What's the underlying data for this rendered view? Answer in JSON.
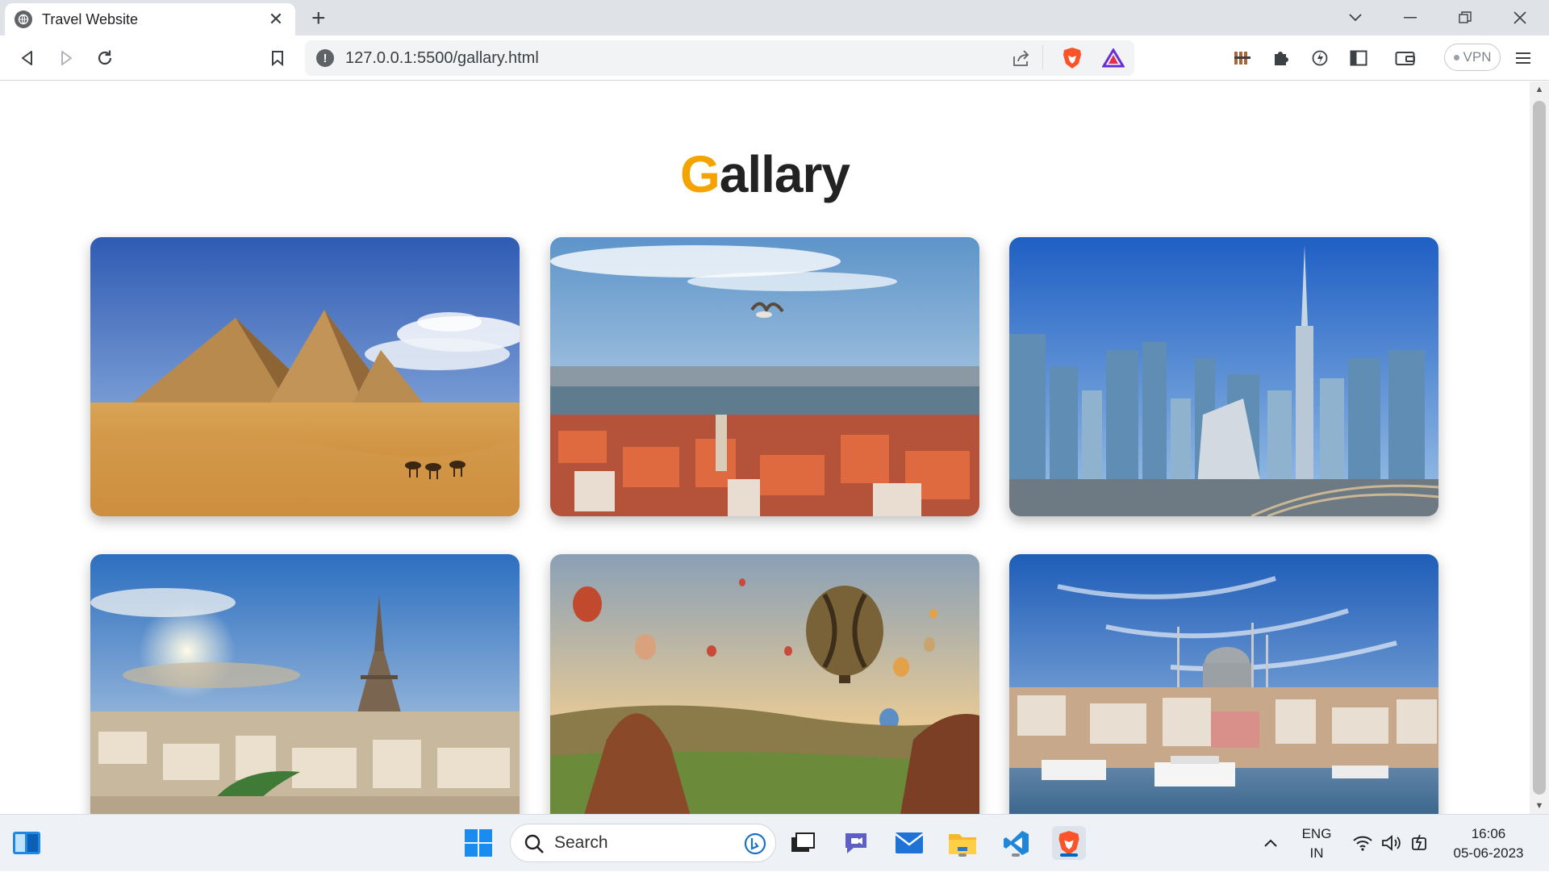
{
  "browser": {
    "tab_title": "Travel Website",
    "tab_close": "✕",
    "new_tab": "+",
    "url": "127.0.0.1:5500/gallary.html",
    "info_icon": "!",
    "vpn_label": "VPN"
  },
  "page": {
    "heading_first": "G",
    "heading_rest": "allary",
    "accent_color": "#f4a300",
    "gallery": [
      {
        "scene": "pyramids-desert"
      },
      {
        "scene": "city-seagull-river"
      },
      {
        "scene": "skyscrapers-skyline"
      },
      {
        "scene": "eiffel-tower-paris"
      },
      {
        "scene": "hot-air-balloons"
      },
      {
        "scene": "mosque-waterfront"
      }
    ]
  },
  "taskbar": {
    "search_label": "Search",
    "lang_top": "ENG",
    "lang_bottom": "IN",
    "time": "16:06",
    "date": "05-06-2023"
  }
}
